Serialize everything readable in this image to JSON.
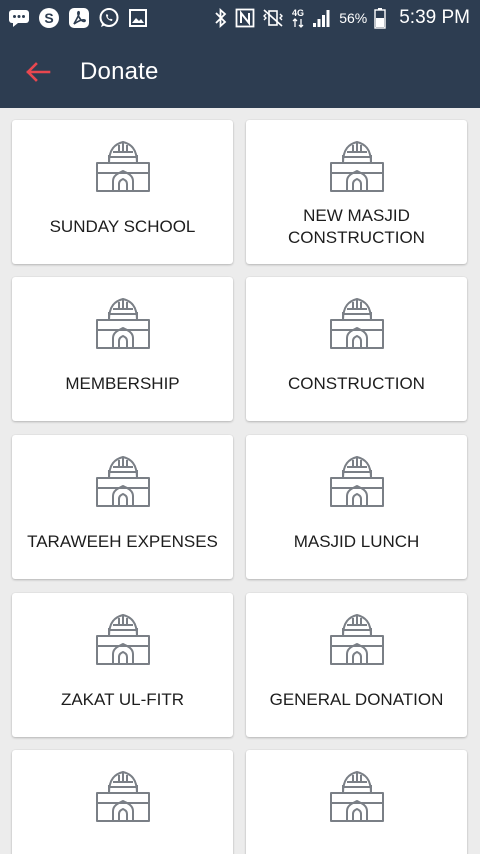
{
  "status_bar": {
    "battery_percent": "56%",
    "time": "5:39 PM",
    "left_icons": [
      "message-icon",
      "skype-icon",
      "acrobat-icon",
      "whatsapp-icon",
      "gallery-icon"
    ],
    "right_icons": [
      "bluetooth-icon",
      "nfc-icon",
      "vibrate-mute-icon",
      "data-4g-icon",
      "signal-icon",
      "battery-icon"
    ]
  },
  "toolbar": {
    "title": "Donate",
    "back_icon": "arrow-left-icon",
    "back_color": "#e8474f"
  },
  "theme": {
    "header_bg": "#2d3d51",
    "page_bg": "#ececec",
    "icon_color": "#7a7f86"
  },
  "categories": [
    {
      "label": "SUNDAY SCHOOL",
      "icon": "mosque-icon"
    },
    {
      "label": "NEW MASJID CONSTRUCTION",
      "icon": "mosque-icon"
    },
    {
      "label": "MEMBERSHIP",
      "icon": "mosque-icon"
    },
    {
      "label": "CONSTRUCTION",
      "icon": "mosque-icon"
    },
    {
      "label": "TARAWEEH EXPENSES",
      "icon": "mosque-icon"
    },
    {
      "label": "MASJID LUNCH",
      "icon": "mosque-icon"
    },
    {
      "label": "ZAKAT UL-FITR",
      "icon": "mosque-icon"
    },
    {
      "label": "GENERAL DONATION",
      "icon": "mosque-icon"
    },
    {
      "label": "",
      "icon": "mosque-icon"
    },
    {
      "label": "",
      "icon": "mosque-icon"
    }
  ]
}
